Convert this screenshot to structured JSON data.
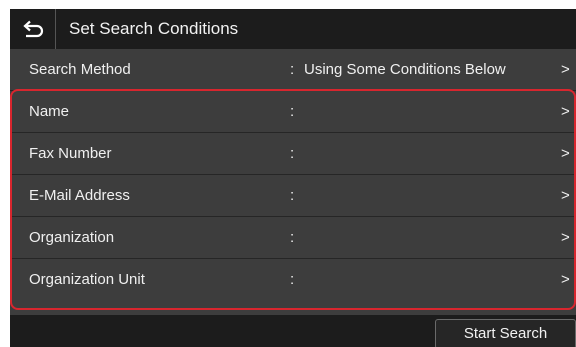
{
  "header": {
    "title": "Set Search Conditions",
    "back_icon": "back-arrow-icon"
  },
  "search_method": {
    "label": "Search Method",
    "colon": ":",
    "value": "Using Some Conditions Below",
    "chevron": ">"
  },
  "conditions": [
    {
      "label": "Name",
      "colon": ":",
      "value": "",
      "chevron": ">"
    },
    {
      "label": "Fax Number",
      "colon": ":",
      "value": "",
      "chevron": ">"
    },
    {
      "label": "E-Mail Address",
      "colon": ":",
      "value": "",
      "chevron": ">"
    },
    {
      "label": "Organization",
      "colon": ":",
      "value": "",
      "chevron": ">"
    },
    {
      "label": "Organization Unit",
      "colon": ":",
      "value": "",
      "chevron": ">"
    }
  ],
  "footer": {
    "start_search_label": "Start Search"
  },
  "colors": {
    "highlight_border": "#d8262e",
    "row_background": "#3d3d3d",
    "bar_background": "#1c1c1c"
  }
}
